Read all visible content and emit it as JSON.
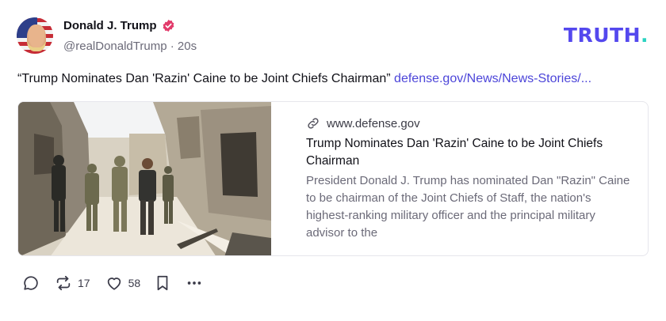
{
  "author": {
    "display_name": "Donald J. Trump",
    "handle": "@realDonaldTrump",
    "separator": "·",
    "time_ago": "20s",
    "verified_color": "#e23b6b"
  },
  "brand": {
    "logo_main": "TRUTH",
    "logo_dot": ".",
    "color": "#5448ee",
    "dot_color": "#2ad3c1"
  },
  "post": {
    "text": "“Trump Nominates Dan 'Razin' Caine to be Joint Chiefs Chairman”",
    "link_text": "defense.gov/News/News-Stories/..."
  },
  "link_card": {
    "domain": "www.defense.gov",
    "title": "Trump Nominates Dan 'Razin' Caine to be Joint Chiefs Chairman",
    "description": "President Donald J. Trump has nominated Dan \"Razin\" Caine to be chairman of the Joint Chiefs of Staff, the nation's highest-ranking military officer and the principal military advisor to the",
    "icons": {
      "link": "link-chain-icon"
    }
  },
  "actions": {
    "reply_icon": "reply-bubble-icon",
    "retruth_icon": "repost-arrows-icon",
    "retruth_count": "17",
    "like_icon": "heart-icon",
    "like_count": "58",
    "bookmark_icon": "bookmark-icon",
    "more_icon": "more-dots-icon"
  }
}
